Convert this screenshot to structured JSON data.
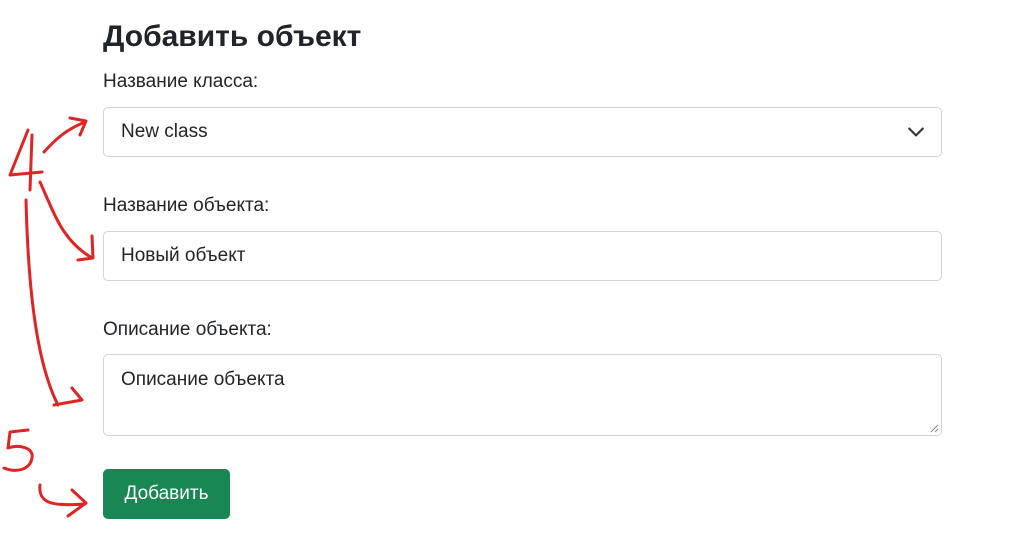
{
  "form": {
    "title": "Добавить объект",
    "class_label": "Название класса:",
    "class_value": "New class",
    "object_label": "Название объекта:",
    "object_value": "Новый объект",
    "description_label": "Описание объекта:",
    "description_value": "Описание объекта",
    "submit_label": "Добавить"
  },
  "annotations": {
    "step_a": "4",
    "step_b": "5"
  },
  "colors": {
    "button": "#198754",
    "annotation": "#e02424",
    "border": "#ced4da"
  },
  "icons": {
    "select_chevron": "chevron-down-icon",
    "textarea_resize": "resize-handle-icon"
  }
}
